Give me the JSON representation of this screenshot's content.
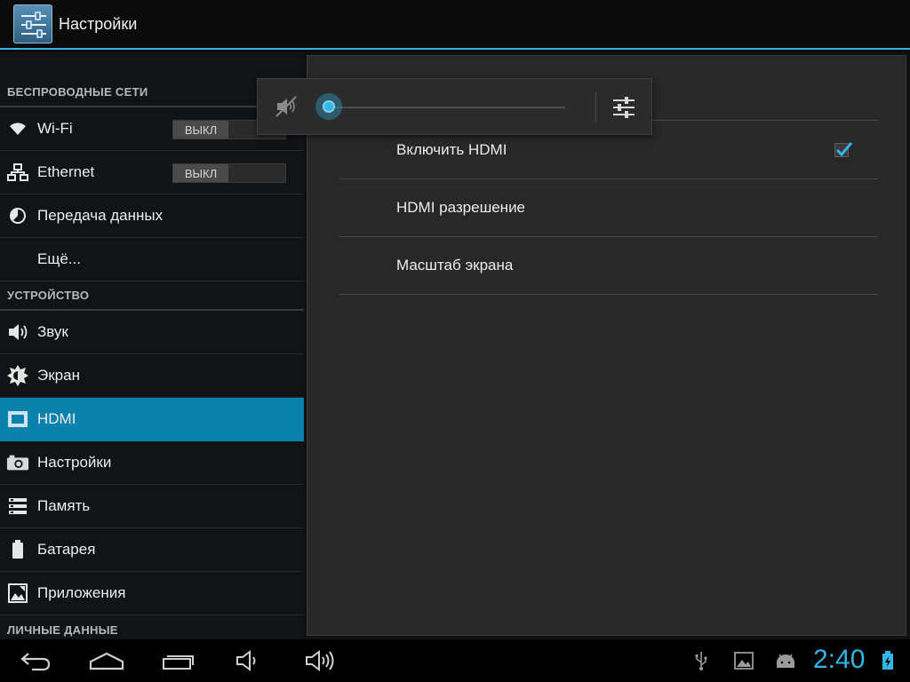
{
  "app": {
    "title": "Настройки"
  },
  "sidebar": {
    "sections": [
      {
        "header": "БЕСПРОВОДНЫЕ СЕТИ"
      },
      {
        "header": "УСТРОЙСТВО"
      },
      {
        "header": "ЛИЧНЫЕ ДАННЫЕ"
      }
    ],
    "items": [
      {
        "label": "Wi-Fi",
        "icon": "wifi-icon",
        "toggle": "ВЫКЛ"
      },
      {
        "label": "Ethernet",
        "icon": "ethernet-icon",
        "toggle": "ВЫКЛ"
      },
      {
        "label": "Передача данных",
        "icon": "data-usage-icon"
      },
      {
        "label": "Ещё...",
        "icon": ""
      },
      {
        "label": "Звук",
        "icon": "speaker-icon"
      },
      {
        "label": "Экран",
        "icon": "brightness-icon"
      },
      {
        "label": "HDMI",
        "icon": "hdmi-icon",
        "selected": true
      },
      {
        "label": "Настройки",
        "icon": "camera-icon"
      },
      {
        "label": "Память",
        "icon": "storage-icon"
      },
      {
        "label": "Батарея",
        "icon": "battery-icon"
      },
      {
        "label": "Приложения",
        "icon": "apps-icon"
      }
    ]
  },
  "hdmi": {
    "rows": [
      {
        "title": "Включить HDMI",
        "checked": true
      },
      {
        "title": "HDMI разрешение"
      },
      {
        "title": "Масштаб экрана"
      }
    ]
  },
  "volume": {
    "muted": true,
    "level": 0
  },
  "status_bar": {
    "time": "2:40"
  },
  "colors": {
    "accent": "#33b5e5",
    "selected_bg": "#0a82ad",
    "panel_bg": "#282829"
  }
}
